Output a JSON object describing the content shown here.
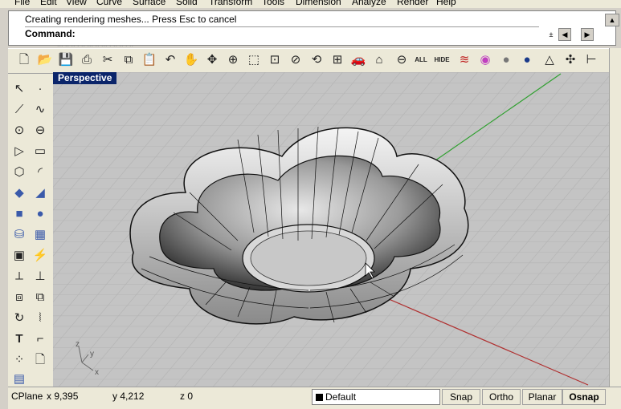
{
  "menu": [
    "File",
    "Edit",
    "View",
    "Curve",
    "Surface",
    "Solid",
    "Transform",
    "Tools",
    "Dimension",
    "Analyze",
    "Render",
    "Help"
  ],
  "command": {
    "history_line": "Creating rendering meshes... Press Esc to cancel",
    "prompt": "Command:",
    "faded_text": "... .. .. . .. ... .. ... . .. .. . .."
  },
  "toolbar_icons": [
    "new-icon",
    "open-icon",
    "save-icon",
    "print-icon",
    "cut-icon",
    "copy-icon",
    "paste-icon",
    "undo-icon",
    "pan-icon",
    "rotate-icon",
    "zoom-icon",
    "zoom-window-icon",
    "zoom-extents-icon",
    "zoom-selected-icon",
    "zoom-dynamic-icon",
    "four-views-icon",
    "car-icon",
    "house-icon",
    "show-icon",
    "all-icon",
    "hide-icon",
    "layers-icon",
    "color-wheel-icon",
    "render-sphere-icon",
    "shade-sphere-icon",
    "light-icon",
    "settings-icon",
    "dimension-icon"
  ],
  "toolbar_text": {
    "all": "ALL",
    "hide": "HIDE"
  },
  "viewport": {
    "title": "Perspective",
    "axis_labels": {
      "x": "x",
      "y": "y",
      "z": "z"
    },
    "colors": {
      "background": "#c4c4c4",
      "grid": "#b4b4b4",
      "x_axis": "#b03030",
      "y_axis": "#30a030"
    }
  },
  "status": {
    "cplane": "CPlane",
    "x": "x 9,395",
    "y": "y 4,212",
    "z": "z 0",
    "layer": "Default",
    "snap": "Snap",
    "ortho": "Ortho",
    "planar": "Planar",
    "osnap": "Osnap"
  }
}
